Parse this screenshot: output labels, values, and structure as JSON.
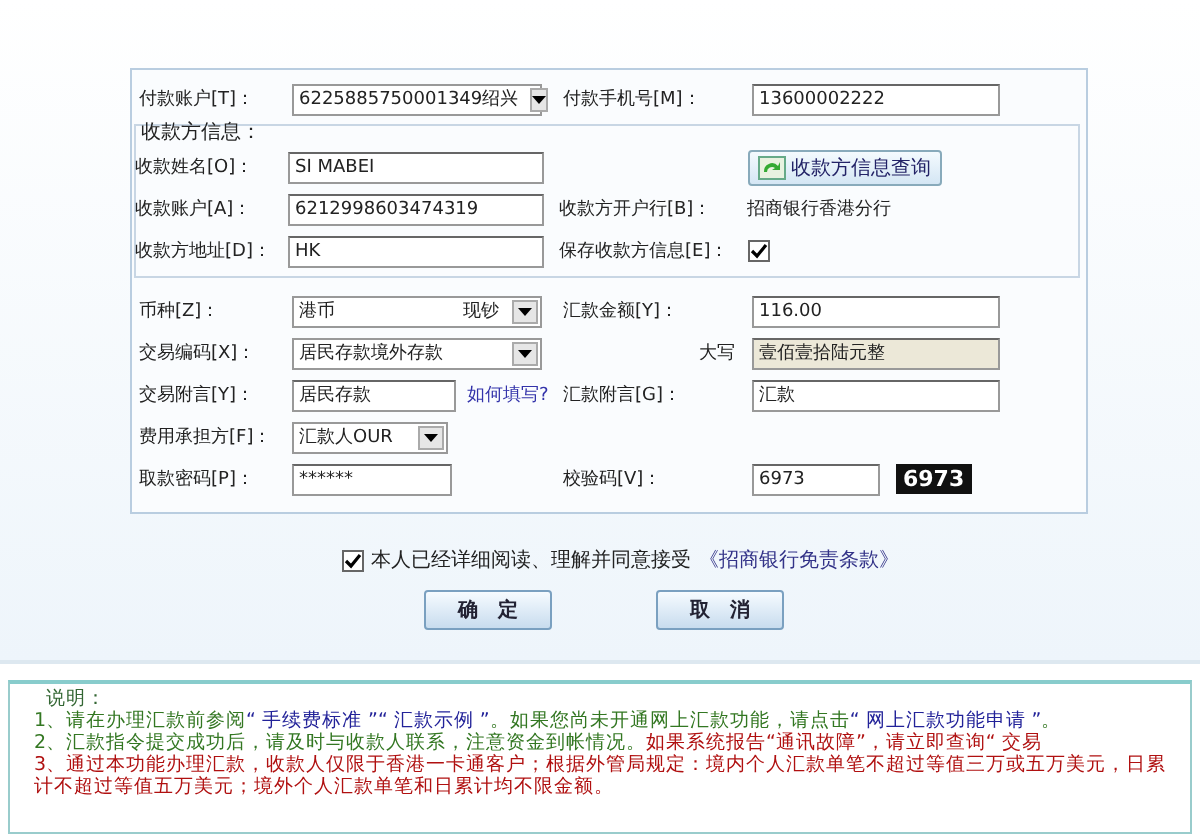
{
  "payer_row": [
    {
      "label": "付款账户[T]：",
      "kind": "select",
      "value": "6225885750001349",
      "option": "绍兴"
    },
    {
      "label": "付款手机号[M]：",
      "kind": "text",
      "value": "13600002222"
    }
  ],
  "payee": {
    "title": "收款方信息：",
    "rows": [
      [
        {
          "label": "收款姓名[O]：",
          "kind": "text",
          "value": "SI MABEI"
        },
        {
          "kind": "button",
          "text": "收款方信息查询"
        }
      ],
      [
        {
          "label": "收款账户[A]：",
          "kind": "text",
          "value": "6212998603474319"
        },
        {
          "label": "收款方开户行[B]：",
          "kind": "static",
          "value": "招商银行香港分行"
        }
      ],
      [
        {
          "label": "收款方地址[D]：",
          "kind": "text",
          "value": "HK"
        },
        {
          "label": "保存收款方信息[E]：",
          "kind": "checkbox",
          "checked": true
        }
      ]
    ]
  },
  "detail_rows": [
    [
      {
        "label": "币种[Z]：",
        "kind": "select",
        "value": "港币",
        "option": "现钞"
      },
      {
        "label": "汇款金额[Y]：",
        "kind": "text",
        "value": "116.00"
      }
    ],
    [
      {
        "label": "交易编码[X]：",
        "kind": "select",
        "value": "居民存款境外存款"
      },
      {
        "label": "大写",
        "kind": "shaded",
        "value": "壹佰壹拾陆元整"
      }
    ],
    [
      {
        "label": "交易附言[Y]：",
        "kind": "text_link",
        "value": "居民存款",
        "link": "如何填写?"
      },
      {
        "label": "汇款附言[G]：",
        "kind": "text",
        "value": "汇款"
      }
    ],
    [
      {
        "label": "费用承担方[F]：",
        "kind": "select",
        "value": "汇款人OUR",
        "short": true
      },
      {
        "kind": "empty"
      }
    ],
    [
      {
        "label": "取款密码[P]：",
        "kind": "text",
        "value": "******",
        "short": true
      },
      {
        "label": "校验码[V]：",
        "kind": "captcha",
        "value": "6973",
        "code": "6973"
      }
    ]
  ],
  "agreement": {
    "checked": true,
    "text": "本人已经详细阅读、理解并同意接受",
    "link": "《招商银行免责条款》"
  },
  "buttons": [
    "确　定",
    "取　消"
  ],
  "notes": {
    "title": "说明：",
    "items": [
      [
        {
          "kind": "plain",
          "text": "1、请在办理汇款前参阅"
        },
        {
          "kind": "link",
          "text": "“ 手续费标准 ”"
        },
        {
          "kind": "link",
          "text": "“ 汇款示例 ”"
        },
        {
          "kind": "plain",
          "text": "。如果您尚未开通网上汇款功能，请点击"
        },
        {
          "kind": "link",
          "text": "“ 网上汇款功能申请 ”"
        },
        {
          "kind": "plain",
          "text": "。"
        }
      ],
      [
        {
          "kind": "plain",
          "text": "2、汇款指令提交成功后，请及时与收款人联系，注意资金到帐情况。"
        },
        {
          "kind": "alert",
          "text": "如果系统报告“通讯故障”，请立即查询“ 交易"
        }
      ],
      [
        {
          "kind": "alert",
          "text": "3、通过本功能办理汇款，收款人仅限于香港一卡通客户；根据外管局规定：境内个人汇款单笔不超过等值三万或五万美元，日累计不超过等值五万美元；境外个人汇款单笔和日累计均不限金额。"
        }
      ]
    ]
  }
}
